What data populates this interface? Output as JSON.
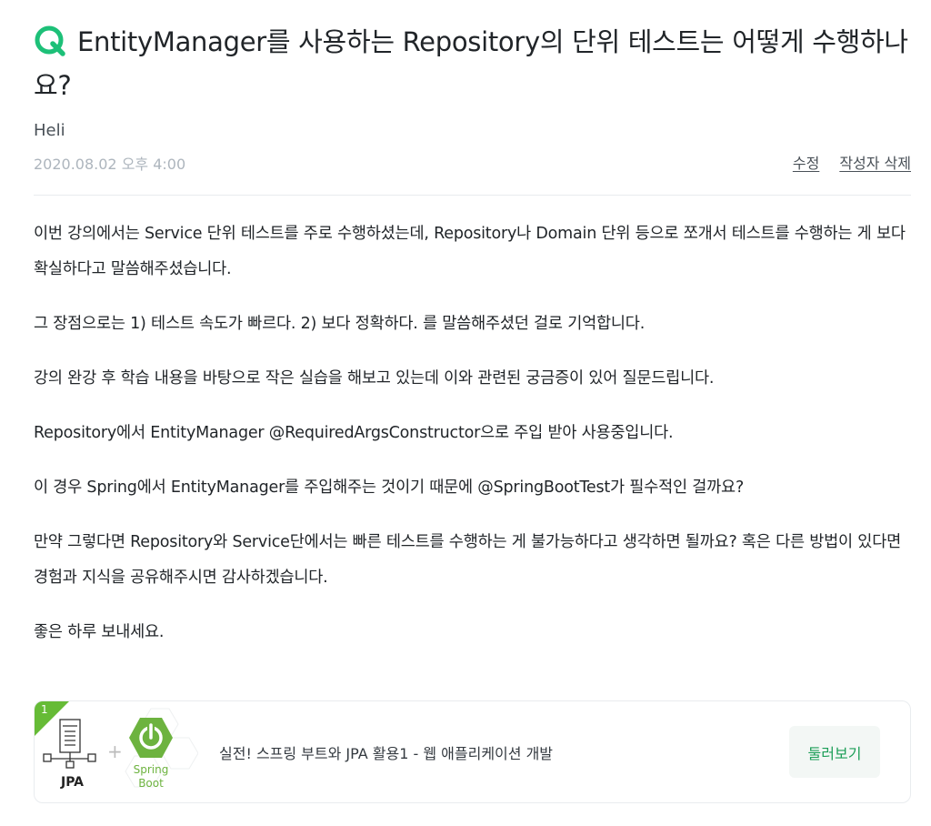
{
  "question": {
    "title": "EntityManager를 사용하는 Repository의 단위 테스트는 어떻게 수행하나요?",
    "author": "Heli",
    "date": "2020.08.02 오후 4:00",
    "actions": {
      "edit": "수정",
      "delete": "작성자 삭제"
    },
    "paragraphs": [
      "이번 강의에서는 Service 단위 테스트를 주로 수행하셨는데, Repository나 Domain 단위 등으로 쪼개서 테스트를 수행하는 게 보다 확실하다고 말씀해주셨습니다.",
      "그 장점으로는 1) 테스트 속도가 빠르다. 2) 보다 정확하다. 를 말씀해주셨던 걸로 기억합니다.",
      "강의 완강 후 학습 내용을 바탕으로 작은 실습을 해보고 있는데 이와 관련된 궁금증이 있어 질문드립니다.",
      "Repository에서 EntityManager @RequiredArgsConstructor으로 주입 받아 사용중입니다.",
      "이 경우 Spring에서 EntityManager를 주입해주는 것이기 때문에 @SpringBootTest가 필수적인 걸까요?",
      "만약 그렇다면 Repository와 Service단에서는 빠른 테스트를 수행하는 게 불가능하다고 생각하면 될까요? 혹은 다른 방법이 있다면 경험과 지식을 공유해주시면 감사하겠습니다.",
      "좋은 하루 보내세요."
    ]
  },
  "course": {
    "badge": "1",
    "thumbnail": {
      "left_label": "JPA",
      "right_label_line1": "Spring",
      "right_label_line2": "Boot",
      "plus": "+"
    },
    "title": "실전! 스프링 부트와 JPA 활용1 - 웹 애플리케이션 개발",
    "button": "둘러보기"
  },
  "colors": {
    "brand_green": "#1dc078",
    "spring_green": "#6db33f",
    "badge_green": "#66bb36"
  },
  "icons": {
    "question": "q-icon"
  }
}
